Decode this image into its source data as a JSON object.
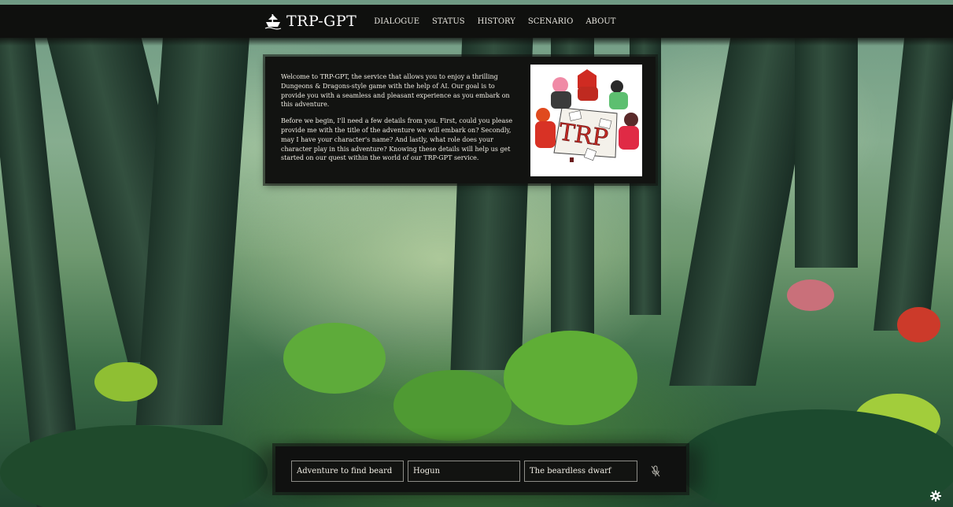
{
  "header": {
    "brand": "TRP-GPT",
    "nav": [
      {
        "label": "DIALOGUE"
      },
      {
        "label": "STATUS"
      },
      {
        "label": "HISTORY"
      },
      {
        "label": "SCENARIO"
      },
      {
        "label": "ABOUT"
      }
    ]
  },
  "welcome": {
    "paragraphs": [
      "Welcome to TRP-GPT, the service that allows you to enjoy a thrilling Dungeons & Dragons-style game with the help of AI. Our goal is to provide you with a seamless and pleasant experience as you embark on this adventure.",
      "Before we begin, I'll need a few details from you. First, could you please provide me with the title of the adventure we will embark on? Secondly, may I have your character's name? And lastly, what role does your character play in this adventure? Knowing these details will help us get started on our quest within the world of our TRP-GPT service."
    ],
    "image_text": "TRP"
  },
  "inputs": {
    "adventure_title": "Adventure to find beard",
    "character_name": "Hogun",
    "character_role": "The beardless dwarf"
  },
  "icons": {
    "brand": "ship-icon",
    "mic": "microphone-muted-icon",
    "settings": "gear-icon"
  },
  "colors": {
    "panel": "#121311",
    "text": "#f1eee5",
    "field_border": "#8d8d88"
  }
}
